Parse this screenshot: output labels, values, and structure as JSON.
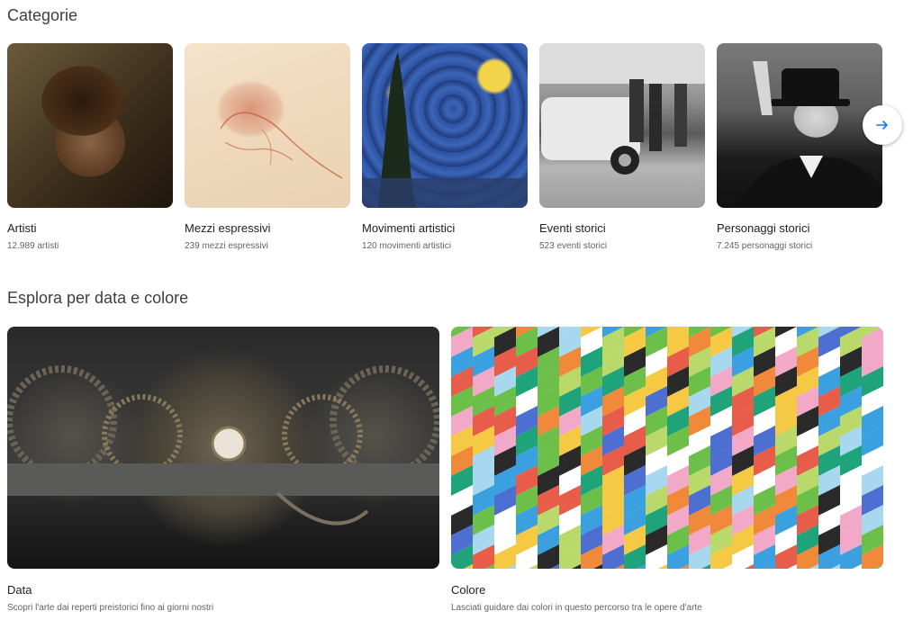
{
  "categories": {
    "title": "Categorie",
    "items": [
      {
        "label": "Artisti",
        "count": "12.989 artisti"
      },
      {
        "label": "Mezzi espressivi",
        "count": "239 mezzi espressivi"
      },
      {
        "label": "Movimenti artistici",
        "count": "120 movimenti artistici"
      },
      {
        "label": "Eventi storici",
        "count": "523 eventi storici"
      },
      {
        "label": "Personaggi storici",
        "count": "7.245 personaggi storici"
      }
    ]
  },
  "explore": {
    "title": "Esplora per data e colore",
    "items": [
      {
        "label": "Data",
        "description": "Scopri l'arte dai reperti preistorici fino ai giorni nostri"
      },
      {
        "label": "Colore",
        "description": "Lasciati guidare dai colori in questo percorso tra le opere d'arte"
      }
    ]
  },
  "colors": {
    "accent": "#1a73e8",
    "stripes": [
      "#f6c945",
      "#3aa0e0",
      "#e85d4a",
      "#2a2a2a",
      "#ffffff",
      "#6cc04a",
      "#f2a9c8",
      "#1fa37a",
      "#b9d96a",
      "#4c6fd1",
      "#f08a3a",
      "#a8d8f0"
    ]
  },
  "icons": {
    "next": "arrow-right-icon"
  }
}
